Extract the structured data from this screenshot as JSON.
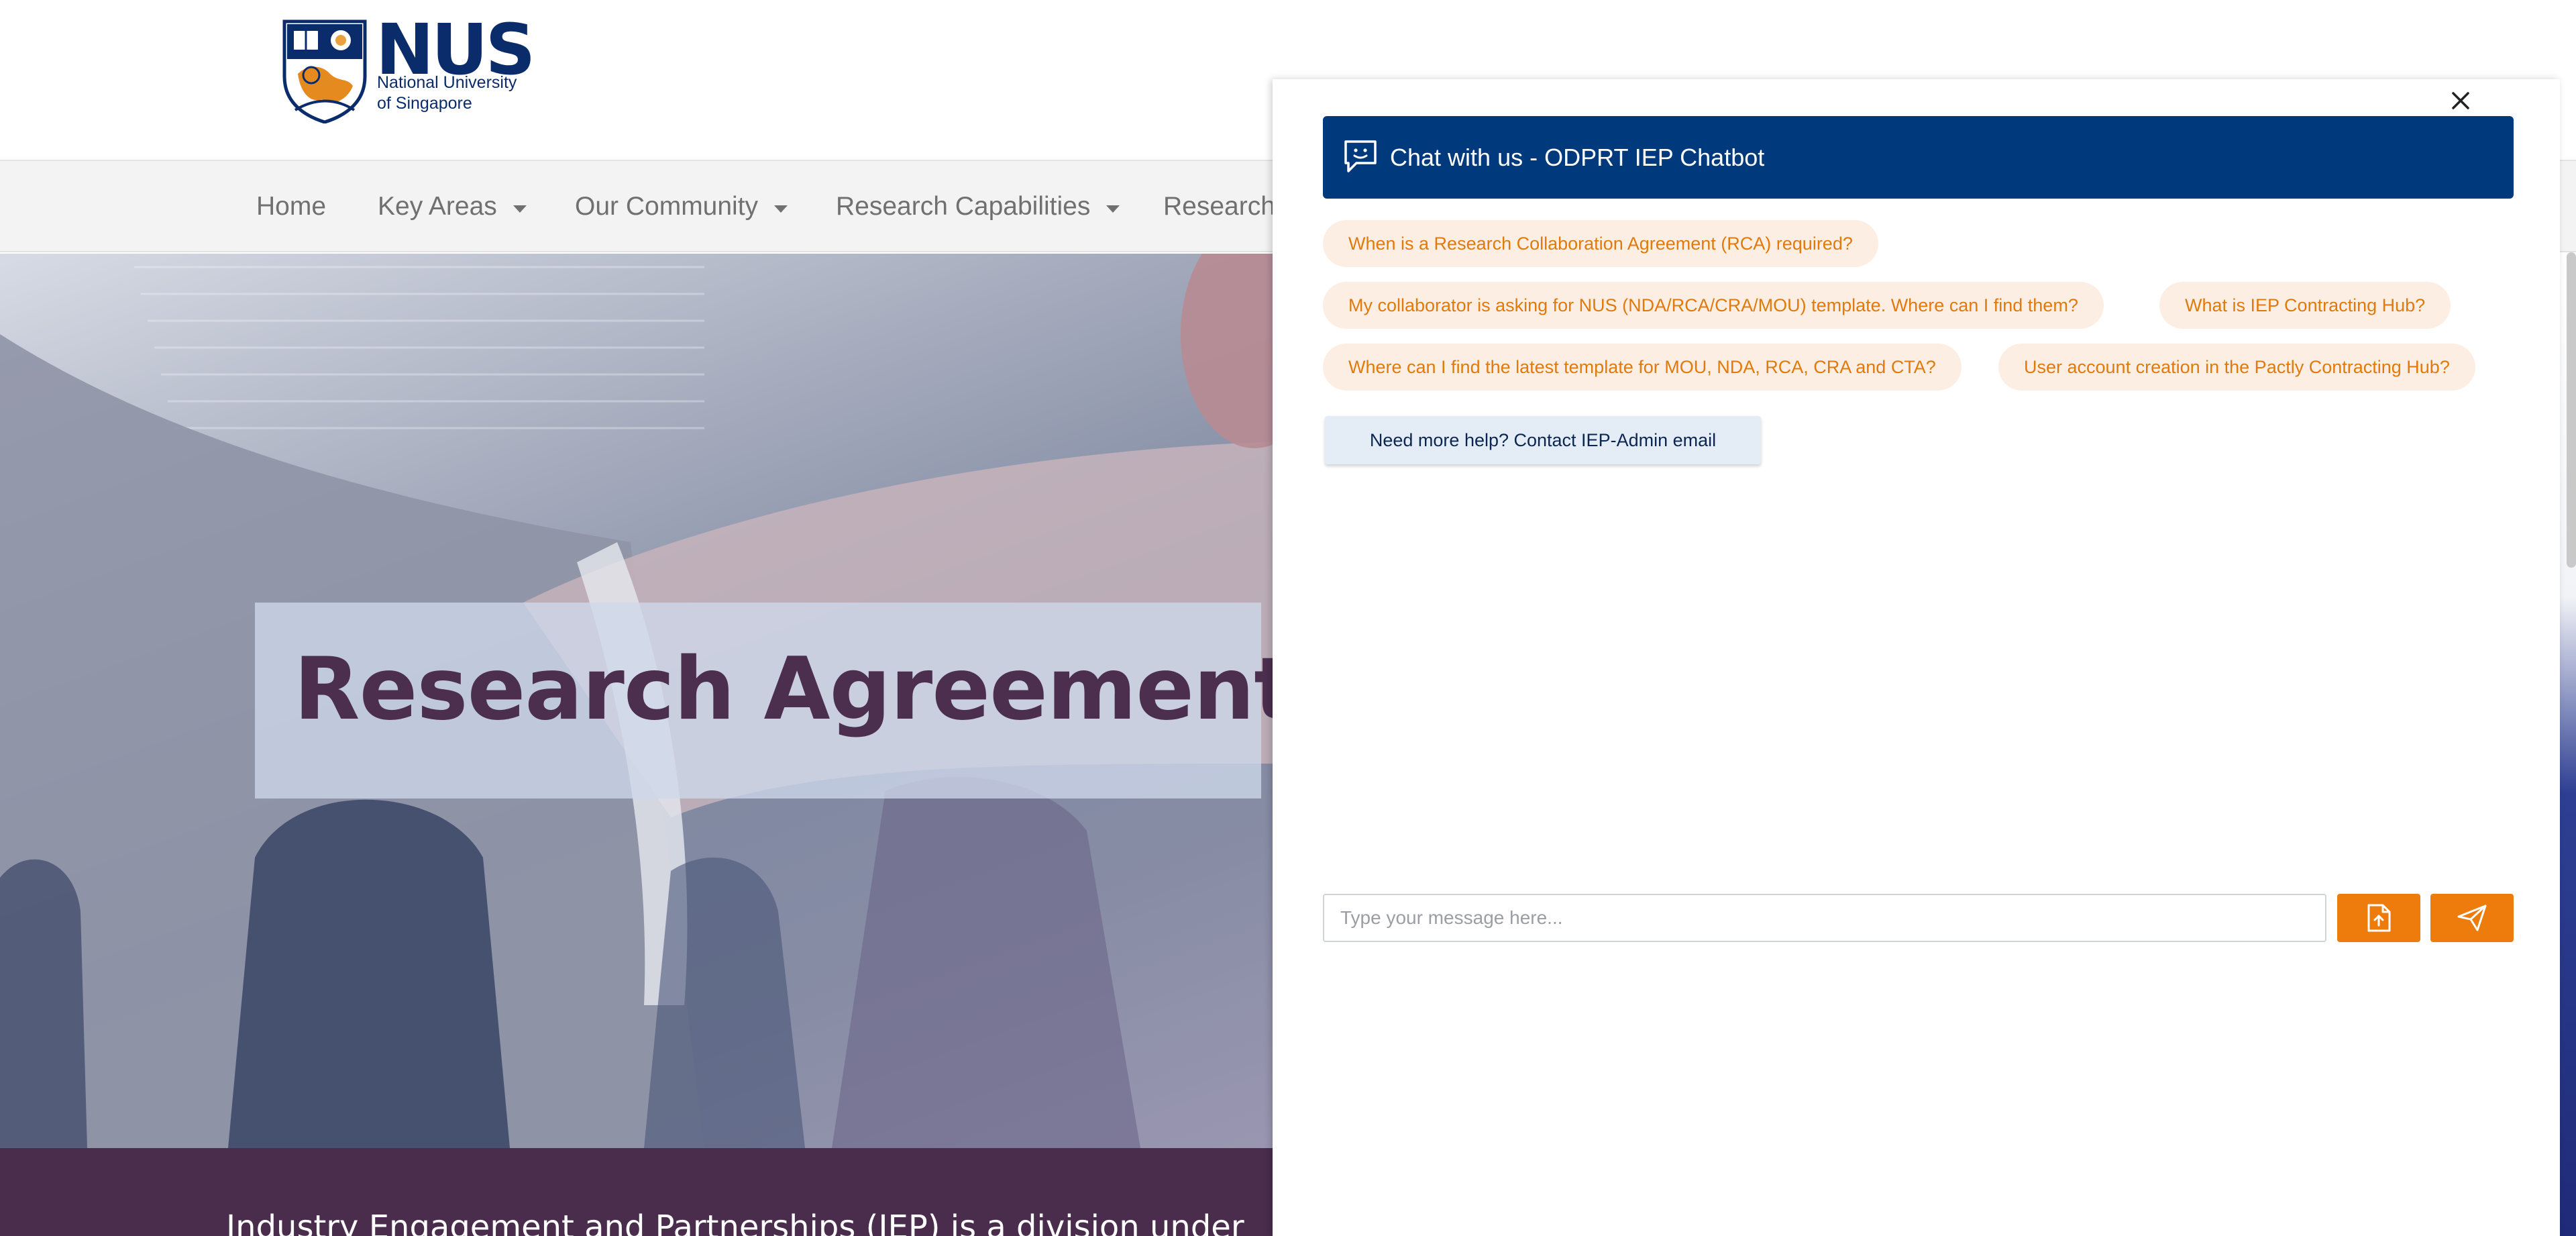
{
  "site": {
    "logo_word": "NUS",
    "logo_sub_line1": "National University",
    "logo_sub_line2": "of Singapore",
    "brand_color": "#0b2c6b"
  },
  "nav": {
    "items": [
      {
        "label": "Home",
        "has_dropdown": false
      },
      {
        "label": "Key Areas",
        "has_dropdown": true
      },
      {
        "label": "Our Community",
        "has_dropdown": true
      },
      {
        "label": "Research Capabilities",
        "has_dropdown": true
      },
      {
        "label": "Research",
        "has_dropdown": false
      }
    ]
  },
  "hero": {
    "title": "Research Agreements",
    "title_color": "#4c2e4f"
  },
  "strip": {
    "text": "Industry Engagement and Partnerships (IEP) is a division under",
    "color": "#4a2c4d"
  },
  "chat": {
    "title": "Chat with us - ODPRT IEP Chatbot",
    "header_color": "#013a7c",
    "close_icon": "close-icon",
    "suggestions": [
      "When is a Research Collaboration Agreement (RCA) required?",
      "My collaborator is asking for NUS (NDA/RCA/CRA/MOU) template. Where can I find them?",
      "What is IEP Contracting Hub?",
      "Where can I find the latest template for MOU, NDA, RCA, CRA and CTA?",
      "User account creation in the Pactly Contracting Hub?"
    ],
    "help_label": "Need more help? Contact IEP-Admin email",
    "input_placeholder": "Type your message here...",
    "input_value": "",
    "upload_icon": "file-upload-icon",
    "send_icon": "send-icon",
    "accent_color": "#ed7c0d"
  }
}
